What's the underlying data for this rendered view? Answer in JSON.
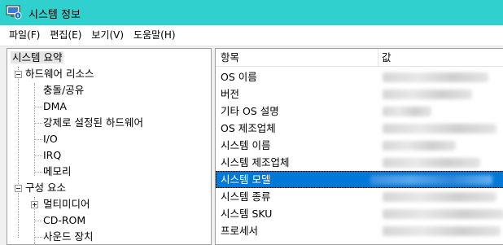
{
  "window": {
    "title": "시스템 정보",
    "icon": "system-info-icon"
  },
  "menu": [
    "파일(F)",
    "편집(E)",
    "보기(V)",
    "도움말(H)"
  ],
  "tree": {
    "root": "시스템 요약",
    "hardware": {
      "label": "하드웨어 리소스",
      "children": [
        "충돌/공유",
        "DMA",
        "강제로 설정된 하드웨어",
        "I/O",
        "IRQ",
        "메모리"
      ]
    },
    "components": {
      "label": "구성 요소",
      "children": [
        "멀티미디어",
        "CD-ROM",
        "사운드 장치"
      ]
    }
  },
  "list": {
    "columns": {
      "item": "항목",
      "value": "값"
    },
    "rows": [
      "OS 이름",
      "버전",
      "기타 OS 설명",
      "OS 제조업체",
      "시스템 이름",
      "시스템 제조업체",
      "시스템 모델",
      "시스템 종류",
      "시스템 SKU",
      "프로세서"
    ],
    "selected_index": 6
  },
  "colors": {
    "titlebar": "#2fd0cd",
    "selection": "#0078d7"
  }
}
